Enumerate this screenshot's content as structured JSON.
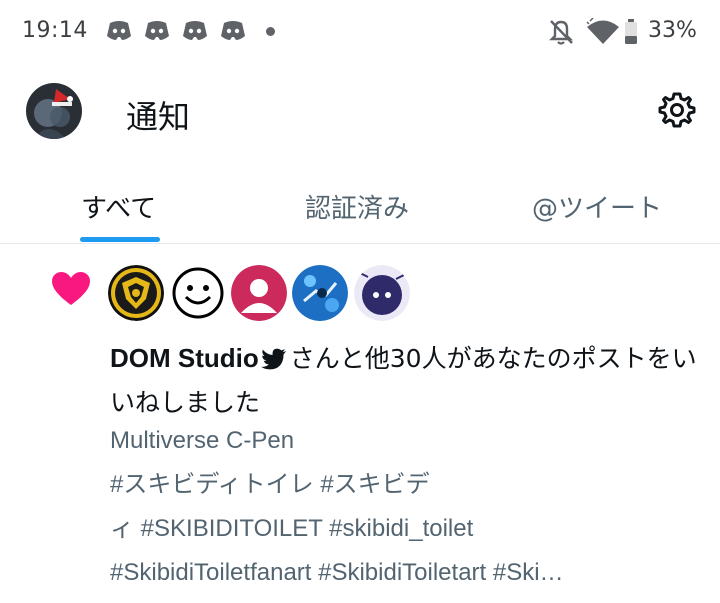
{
  "status_bar": {
    "time": "19:14",
    "notification_icons": [
      "discord-icon",
      "discord-icon",
      "discord-icon",
      "discord-icon"
    ],
    "battery_percent": "33%"
  },
  "header": {
    "title": "通知"
  },
  "tabs": [
    {
      "label": "すべて",
      "active": true
    },
    {
      "label": "認証済み",
      "active": false
    },
    {
      "label": "@ツイート",
      "active": false
    }
  ],
  "notification": {
    "type": "like",
    "actor_name": "DOM Studio",
    "text_after_name": "さんと他30人があなたのポストをいいねしました",
    "post_title": "Multiverse C-Pen",
    "post_hashtags_line1": "#スキビディトイレ #スキビデ",
    "post_hashtags_line2": "ィ #SKIBIDITOILET #skibidi_toilet",
    "post_hashtags_line3": "#SkibidiToiletfanart #SkibidiToiletart #Ski…"
  },
  "colors": {
    "accent": "#1d9bf0",
    "like": "#f91880",
    "secondary_text": "#536471"
  }
}
